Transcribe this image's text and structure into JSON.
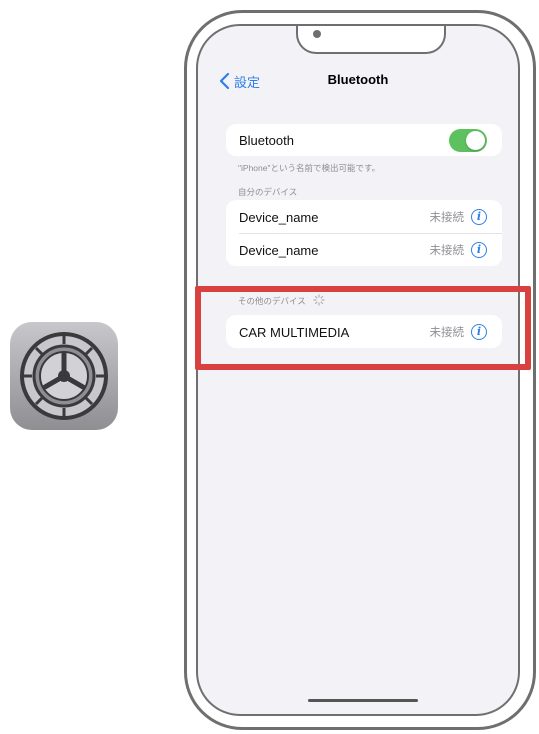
{
  "nav": {
    "back_label": "設定",
    "title": "Bluetooth"
  },
  "bluetooth": {
    "label": "Bluetooth",
    "enabled": true,
    "discoverable_note": "\"iPhone\"という名前で検出可能です。"
  },
  "my_devices": {
    "header": "自分のデバイス",
    "items": [
      {
        "name": "Device_name",
        "status": "未接続"
      },
      {
        "name": "Device_name",
        "status": "未接続"
      }
    ]
  },
  "other_devices": {
    "header": "その他のデバイス",
    "items": [
      {
        "name": "CAR MULTIMEDIA",
        "status": "未接続"
      }
    ]
  },
  "colors": {
    "accent": "#2f7fe8",
    "toggle_on": "#5ec15f",
    "highlight": "#d94040"
  },
  "icons": {
    "settings_app": "gear-icon",
    "back": "chevron-left-icon",
    "info": "info-icon",
    "scanning": "spinner-icon"
  }
}
